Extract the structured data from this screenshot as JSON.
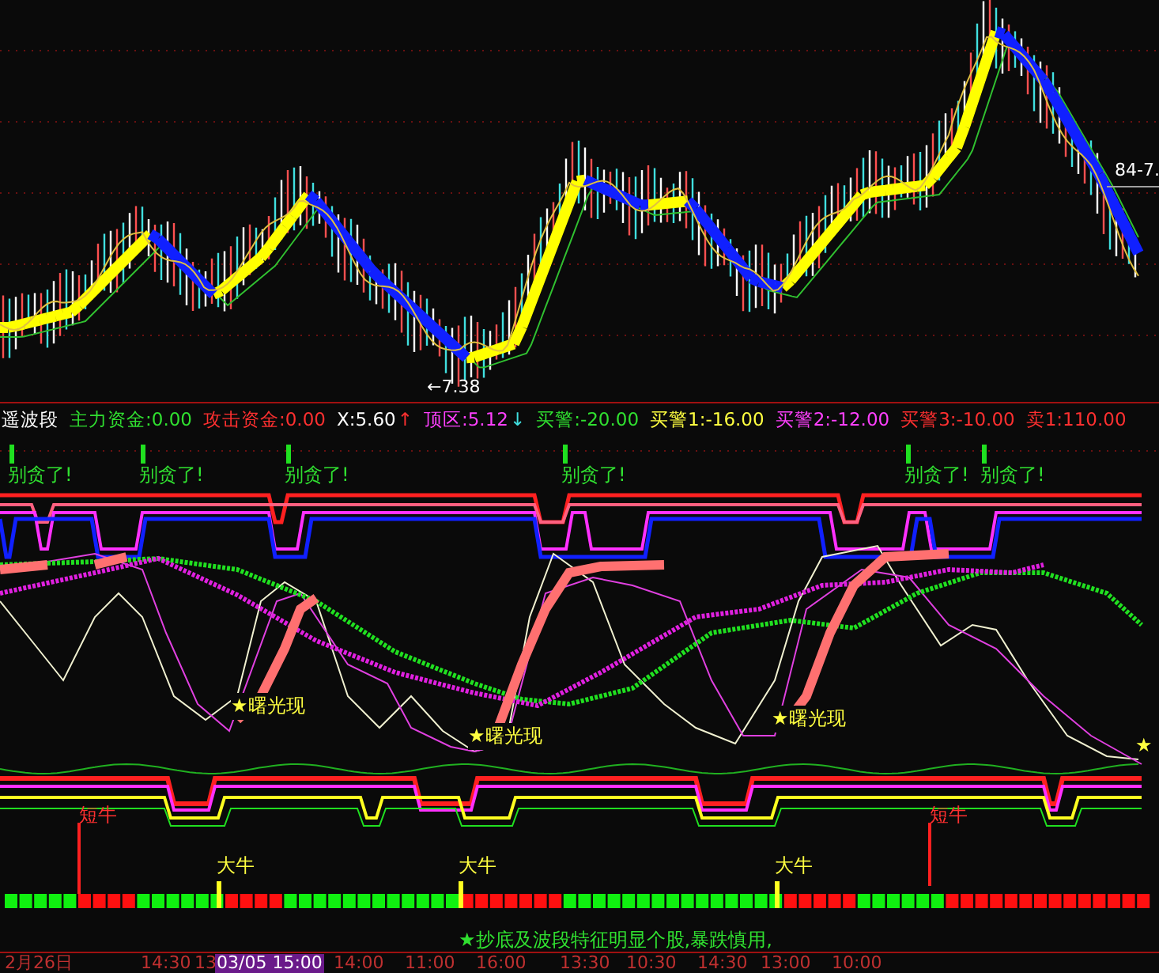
{
  "price_panel": {
    "low_label": "←7.38",
    "right_label": "84-7."
  },
  "indicator_header": [
    {
      "text": "遥波段",
      "color": "#ffffff"
    },
    {
      "text": "主力资金:0.00",
      "color": "#30e030"
    },
    {
      "text": "攻击资金:0.00",
      "color": "#ff3030"
    },
    {
      "text": "X:5.60",
      "color": "#ffffff"
    },
    {
      "text": "↑",
      "color": "#ff3030"
    },
    {
      "text": "顶区:5.12",
      "color": "#ff40ff"
    },
    {
      "text": "↓",
      "color": "#40e0e0"
    },
    {
      "text": "买警:-20.00",
      "color": "#30e030"
    },
    {
      "text": "买警1:-16.00",
      "color": "#ffff40"
    },
    {
      "text": "买警2:-12.00",
      "color": "#ff40ff"
    },
    {
      "text": "买警3:-10.00",
      "color": "#ff3030"
    },
    {
      "text": "卖1:110.00",
      "color": "#ff3030"
    }
  ],
  "warnings": [
    "别贪了!",
    "别贪了!",
    "别贪了!",
    "别贪了!",
    "别贪了!",
    "别贪了!"
  ],
  "dawn_signals": [
    "★曙光现",
    "★曙光现",
    "★曙光现",
    "★"
  ],
  "bull_signals": [
    {
      "kind": "short",
      "text": "短牛"
    },
    {
      "kind": "big",
      "text": "大牛"
    },
    {
      "kind": "big",
      "text": "大牛"
    },
    {
      "kind": "big",
      "text": "大牛"
    },
    {
      "kind": "short",
      "text": "短牛"
    }
  ],
  "footer_note": "★抄底及波段特征明显个股,暴跌慎用,",
  "time_axis": [
    {
      "label": "2月26日",
      "selected": false
    },
    {
      "label": "14:30",
      "selected": false
    },
    {
      "label": "13",
      "selected": false
    },
    {
      "label": "03/05 15:00",
      "selected": true
    },
    {
      "label": "14:00",
      "selected": false
    },
    {
      "label": "11:00",
      "selected": false
    },
    {
      "label": "16:00",
      "selected": false
    },
    {
      "label": "13:30",
      "selected": false
    },
    {
      "label": "10:30",
      "selected": false
    },
    {
      "label": "14:30",
      "selected": false
    },
    {
      "label": "13:00",
      "selected": false
    },
    {
      "label": "10:00",
      "selected": false
    }
  ]
}
